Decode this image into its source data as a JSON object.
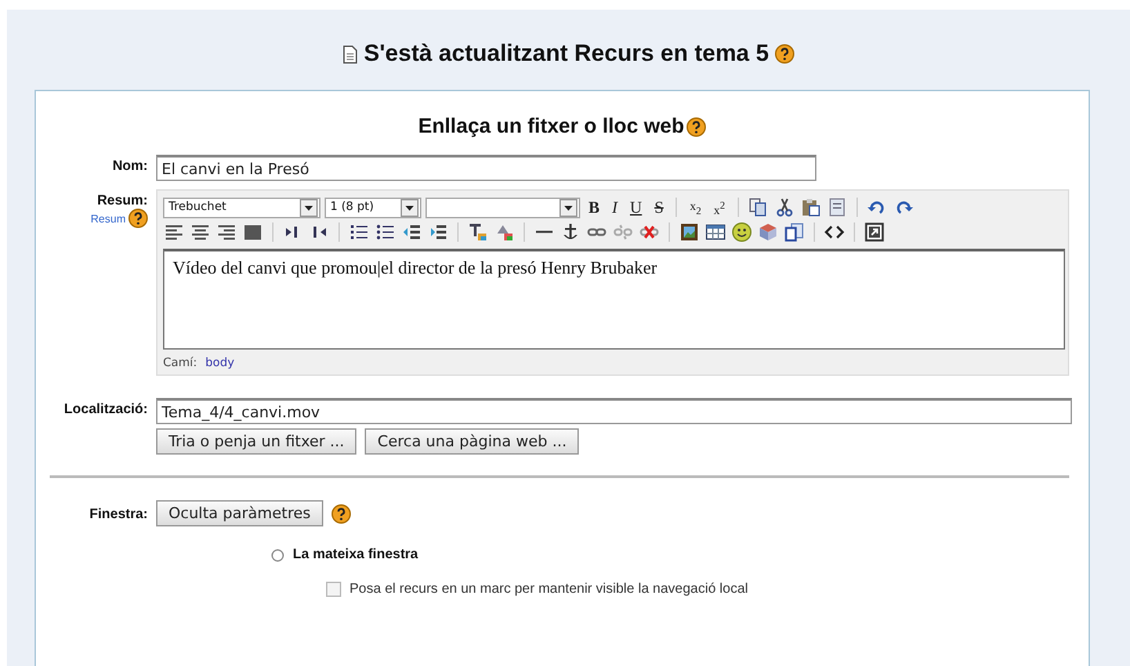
{
  "page_title": "S'està actualitzant Recurs en tema 5",
  "form": {
    "heading": "Enllaça un fitxer o lloc web",
    "name": {
      "label": "Nom:",
      "value": "El canvi en la Presó"
    },
    "summary": {
      "label": "Resum:",
      "help_link": "Resum",
      "toolbar": {
        "font": "Trebuchet",
        "size": "1 (8 pt)",
        "format_buttons": [
          "B",
          "I",
          "U",
          "S",
          "x$_{2}$",
          "x$^{2}$"
        ]
      },
      "content": "Vídeo del canvi que promou|el director de la presó Henry Brubaker",
      "path_label": "Camí:",
      "path_value": "body"
    },
    "location": {
      "label": "Localització:",
      "value": "Tema_4/4_canvi.mov",
      "buttons": [
        "Tria o penja un fitxer ...",
        "Cerca una pàgina web ..."
      ]
    },
    "window": {
      "label": "Finestra:",
      "button": "Oculta paràmetres",
      "radio": {
        "label": "La mateixa finestra",
        "selected": false
      },
      "checkbox": {
        "label": "Posa el recurs en un marc per mantenir visible la navegació local",
        "checked": false,
        "disabled": true
      }
    }
  }
}
